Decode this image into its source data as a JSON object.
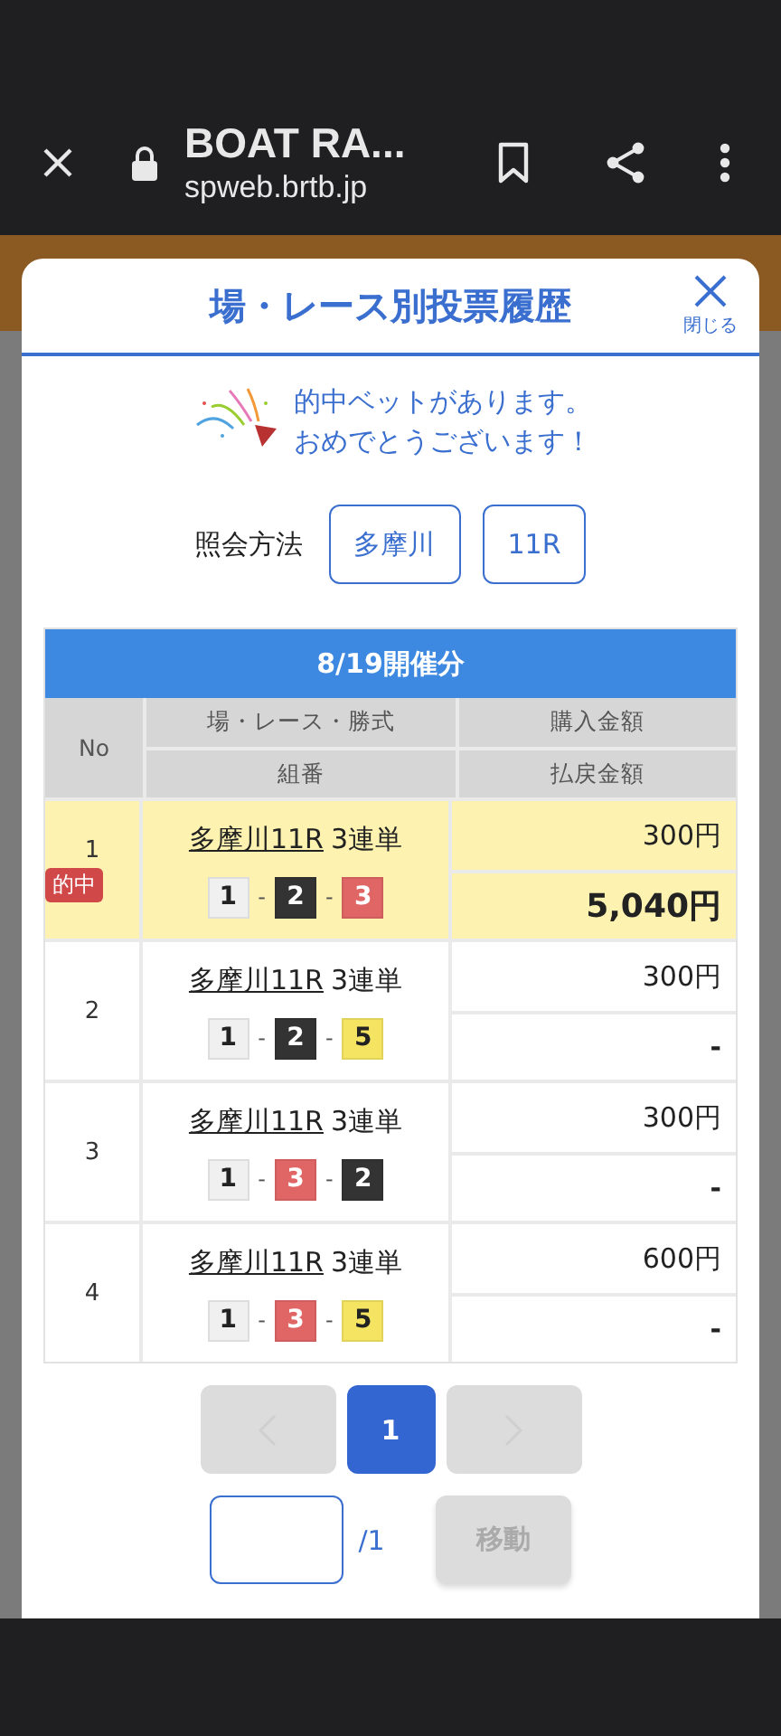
{
  "browser": {
    "title": "BOAT RA...",
    "url": "spweb.brtb.jp"
  },
  "modal": {
    "title": "場・レース別投票履歴",
    "close_label": "閉じる"
  },
  "message": {
    "lines": [
      "的中ベットがあります。",
      "おめでとうございます！"
    ]
  },
  "query": {
    "label": "照会方法",
    "chips": [
      "多摩川",
      "11R"
    ]
  },
  "table": {
    "date_header": "8/19開催分",
    "columns": {
      "no": "No",
      "race": "場・レース・勝式",
      "combo": "組番",
      "purchase": "購入金額",
      "payout": "払戻金額"
    },
    "rows": [
      {
        "no": "1",
        "hit": true,
        "badge": "的中",
        "race": "多摩川11R",
        "bet_type": "3連単",
        "purchase": "300円",
        "payout": "5,040円",
        "combination": [
          {
            "kind": "boat",
            "number": "1",
            "color": "#f0f0f0"
          },
          {
            "kind": "sep",
            "text": "-"
          },
          {
            "kind": "boat",
            "number": "2",
            "color": "#333333"
          },
          {
            "kind": "sep",
            "text": "-"
          },
          {
            "kind": "boat",
            "number": "3",
            "color": "#e06666"
          }
        ]
      },
      {
        "no": "2",
        "hit": false,
        "race": "多摩川11R",
        "bet_type": "3連単",
        "purchase": "300円",
        "payout": "-",
        "combination": [
          {
            "kind": "boat",
            "number": "1",
            "color": "#f0f0f0"
          },
          {
            "kind": "sep",
            "text": "-"
          },
          {
            "kind": "boat",
            "number": "2",
            "color": "#333333"
          },
          {
            "kind": "sep",
            "text": "-"
          },
          {
            "kind": "boat",
            "number": "5",
            "color": "#f5e462"
          }
        ]
      },
      {
        "no": "3",
        "hit": false,
        "race": "多摩川11R",
        "bet_type": "3連単",
        "purchase": "300円",
        "payout": "-",
        "combination": [
          {
            "kind": "boat",
            "number": "1",
            "color": "#f0f0f0"
          },
          {
            "kind": "sep",
            "text": "-"
          },
          {
            "kind": "boat",
            "number": "3",
            "color": "#e06666"
          },
          {
            "kind": "sep",
            "text": "-"
          },
          {
            "kind": "boat",
            "number": "2",
            "color": "#333333"
          }
        ]
      },
      {
        "no": "4",
        "hit": false,
        "race": "多摩川11R",
        "bet_type": "3連単",
        "purchase": "600円",
        "payout": "-",
        "combination": [
          {
            "kind": "boat",
            "number": "1",
            "color": "#f0f0f0"
          },
          {
            "kind": "sep",
            "text": "-"
          },
          {
            "kind": "boat",
            "number": "3",
            "color": "#e06666"
          },
          {
            "kind": "sep",
            "text": "-"
          },
          {
            "kind": "boat",
            "number": "5",
            "color": "#f5e462"
          }
        ]
      }
    ]
  },
  "pagination": {
    "prev_disabled": true,
    "next_disabled": true,
    "pages": [
      {
        "label": "1",
        "selected": true
      }
    ]
  },
  "jump": {
    "total": "/1",
    "button": "移動",
    "button_disabled": true
  }
}
